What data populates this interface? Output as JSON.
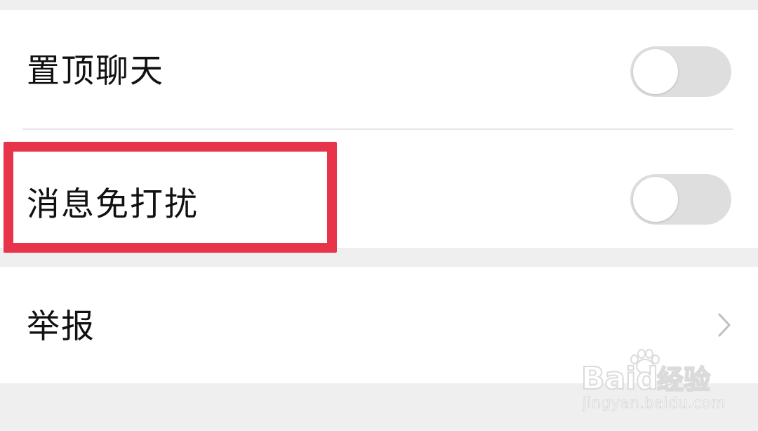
{
  "chat_settings": {
    "rows": [
      {
        "label": "置顶聊天",
        "control": "toggle",
        "enabled": false
      },
      {
        "label": "消息免打扰",
        "control": "toggle",
        "enabled": false
      },
      {
        "label": "举报",
        "control": "chevron",
        "icon": "chevron-right-icon"
      }
    ]
  },
  "watermark": {
    "brand": "Baidu",
    "brand_cn": "经验",
    "url": "jingyan.baidu.com",
    "icon": "baidu-paw-icon"
  },
  "colors": {
    "background": "#efefef",
    "panel": "#ffffff",
    "text": "#111111",
    "toggle_off": "#dedede",
    "highlight": "#e8344b",
    "chevron": "#bfbfbf"
  }
}
